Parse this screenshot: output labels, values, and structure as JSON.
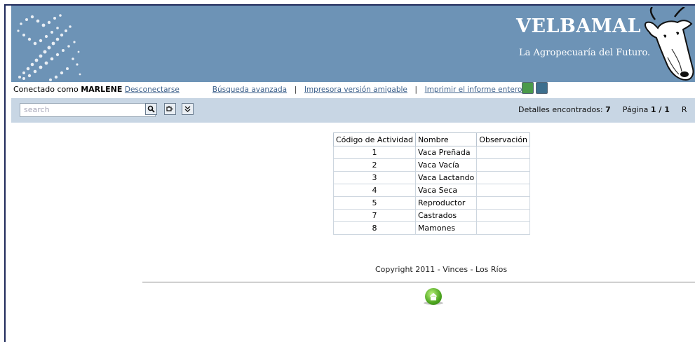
{
  "header": {
    "brand_title": "VELBAMAL",
    "brand_subtitle": "La Agropecuaría del Futuro."
  },
  "topbar": {
    "connected_prefix": "Conectado como",
    "user": "MARLENE",
    "logout": "Desconectarse",
    "advanced_search": "Búsqueda avanzada",
    "printer_friendly": "Impresora versión amigable",
    "print_all": "Imprimir el informe entero",
    "separator": "|"
  },
  "toolbar": {
    "search_placeholder": "search",
    "found_label": "Detalles encontrados:",
    "found_count": "7",
    "page_label": "Página",
    "page_value": "1 / 1",
    "trailing": "R"
  },
  "table": {
    "headers": [
      "Código de Actividad",
      "Nombre",
      "Observación"
    ],
    "rows": [
      {
        "code": "1",
        "name": "Vaca Preñada",
        "obs": ""
      },
      {
        "code": "2",
        "name": "Vaca Vacía",
        "obs": ""
      },
      {
        "code": "3",
        "name": "Vaca Lactando",
        "obs": ""
      },
      {
        "code": "4",
        "name": "Vaca Seca",
        "obs": ""
      },
      {
        "code": "5",
        "name": "Reproductor",
        "obs": ""
      },
      {
        "code": "7",
        "name": "Castrados",
        "obs": ""
      },
      {
        "code": "8",
        "name": "Mamones",
        "obs": ""
      }
    ]
  },
  "footer": {
    "copyright": "Copyright 2011 - Vinces - Los Ríos"
  },
  "colors": {
    "banner": "#6d93b6",
    "toolbar": "#c8d6e4",
    "link": "#3b5f8a"
  },
  "icons": [
    "search-icon",
    "filter-icon",
    "expand-icon",
    "excel-icon",
    "word-icon",
    "home-icon"
  ]
}
